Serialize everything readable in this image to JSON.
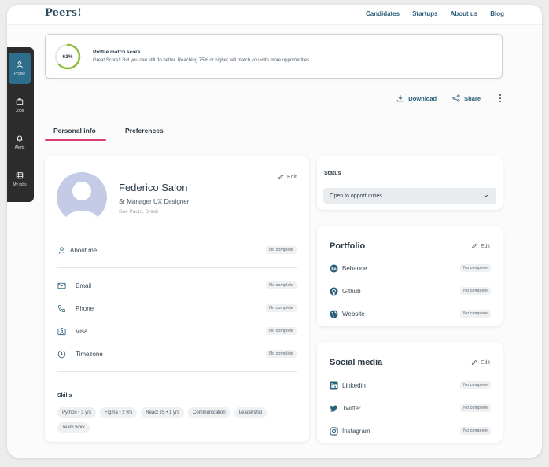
{
  "app": {
    "logo": "Peers!",
    "nav": [
      "Candidates",
      "Startups",
      "About us",
      "Blog"
    ]
  },
  "rail": [
    {
      "label": "Profile",
      "icon": "person-icon",
      "active": true
    },
    {
      "label": "Jobs",
      "icon": "briefcase-icon",
      "active": false
    },
    {
      "label": "Alerts",
      "icon": "bell-icon",
      "active": false
    },
    {
      "label": "My jobs",
      "icon": "calendar-icon",
      "active": false
    }
  ],
  "score": {
    "value": "63%",
    "percent": 63,
    "title": "Profile match score",
    "description": "Great Score!! But you can still do better. Reaching 75% or higher will match you with more opportunities."
  },
  "actions": {
    "download": "Download",
    "share": "Share"
  },
  "tabs": [
    "Personal info",
    "Preferences"
  ],
  "profile": {
    "name": "Federico Salon",
    "role": "Sr Manager UX Designer",
    "location": "Sao Paulo, Brasil",
    "edit": "Edit",
    "about": {
      "label": "About me",
      "badge": "No complete"
    },
    "fields": [
      {
        "label": "Email",
        "badge": "No complete"
      },
      {
        "label": "Phone",
        "badge": "No complete"
      },
      {
        "label": "Visa",
        "badge": "No complete"
      },
      {
        "label": "Timezone",
        "badge": "No complete"
      }
    ],
    "skills_title": "Skills",
    "skills": [
      "Python • 3 yrs",
      "Figma • 2 yrs",
      "React JS • 1 yrs",
      "Communication",
      "Leadership",
      "Team work"
    ]
  },
  "status": {
    "label": "Status",
    "value": "Open to opportunities"
  },
  "portfolio": {
    "title": "Portfolio",
    "edit": "Edit",
    "items": [
      {
        "label": "Behance",
        "badge": "No complete"
      },
      {
        "label": "Github",
        "badge": "No complete"
      },
      {
        "label": "Website",
        "badge": "No complete"
      }
    ]
  },
  "social": {
    "title": "Social media",
    "edit": "Edit",
    "items": [
      {
        "label": "Linkedin",
        "badge": "No complete"
      },
      {
        "label": "Twitter",
        "badge": "No complete"
      },
      {
        "label": "Instagram",
        "badge": "No complete"
      }
    ]
  },
  "colors": {
    "accent": "#2f6e8a",
    "tab_underline": "#d83e78",
    "ring": "#8fbc3b"
  }
}
